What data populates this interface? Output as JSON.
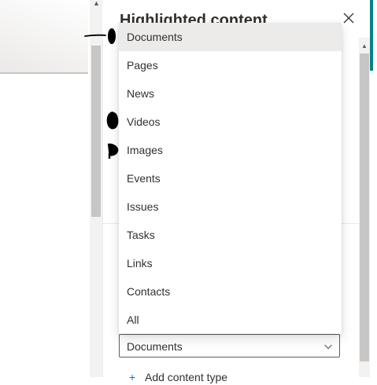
{
  "pane": {
    "title": "Highlighted content",
    "close_icon": "close-icon"
  },
  "content_type_dropdown": {
    "selected": "Documents",
    "options": [
      "Documents",
      "Pages",
      "News",
      "Videos",
      "Images",
      "Events",
      "Issues",
      "Tasks",
      "Links",
      "Contacts",
      "All"
    ]
  },
  "add_content_type": {
    "label": "Add content type"
  },
  "colors": {
    "accent": "#038387",
    "selected_bg": "#edebe9",
    "link": "#0078d4"
  }
}
